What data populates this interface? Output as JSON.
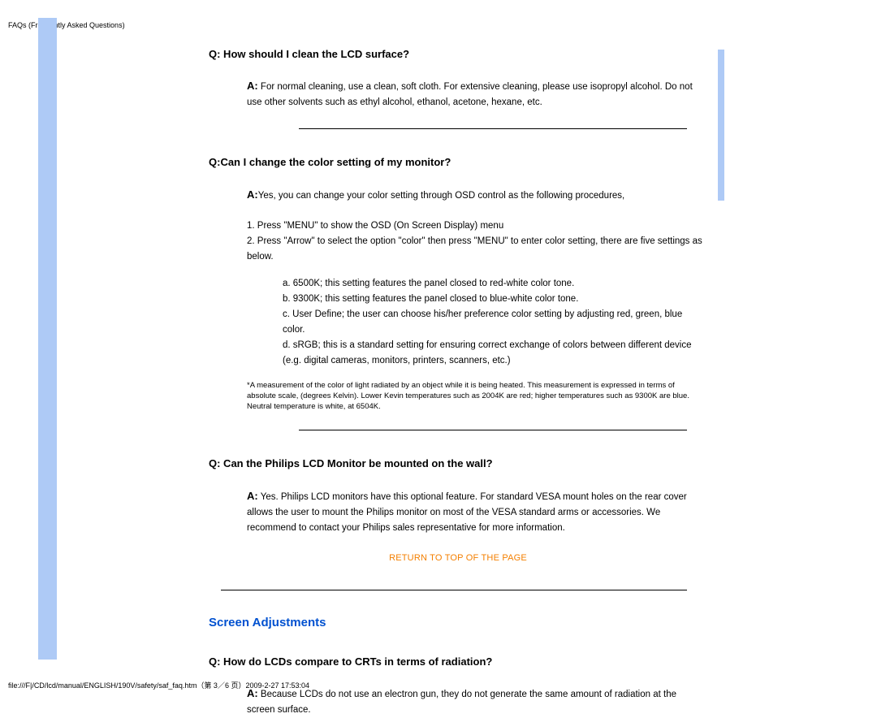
{
  "header": "FAQs (Frequently Asked Questions)",
  "faq1": {
    "q": "Q: How should I clean the LCD surface?",
    "a_label": "A:",
    "a": " For normal cleaning, use a clean, soft cloth. For extensive cleaning, please use isopropyl alcohol. Do not use other solvents such as ethyl alcohol, ethanol, acetone, hexane, etc."
  },
  "faq2": {
    "q": "Q:Can I change the color setting of my monitor?",
    "a_label": "A:",
    "a": "Yes, you can change your color setting through OSD control as the following procedures,",
    "step1": "1. Press \"MENU\" to show the OSD (On Screen Display) menu",
    "step2": "2. Press \"Arrow\" to select the option \"color\" then press \"MENU\" to enter color setting, there are five settings as below.",
    "opt_a": "a. 6500K; this setting features the panel closed to red-white color tone.",
    "opt_b": "b. 9300K; this setting features the panel closed to blue-white color tone.",
    "opt_c": "c. User Define; the user can choose his/her preference color setting by adjusting red, green, blue color.",
    "opt_d": "d. sRGB; this is a standard setting for ensuring correct exchange of colors between different device (e.g. digital cameras, monitors, printers, scanners, etc.)",
    "footnote": "*A measurement of the color of light radiated by an object while it is being heated. This measurement is expressed in terms of absolute scale, (degrees Kelvin). Lower Kevin temperatures such as 2004K are red; higher temperatures such as 9300K are blue. Neutral temperature is white, at 6504K."
  },
  "faq3": {
    "q": "Q: Can the Philips LCD Monitor be mounted on the wall?",
    "a_label": "A:",
    "a": " Yes. Philips LCD monitors have this optional feature. For standard VESA mount holes on the rear cover allows the user to mount the Philips monitor on most of the VESA standard arms or accessories. We recommend to contact your Philips sales representative for more information."
  },
  "return_link": "RETURN TO TOP OF THE PAGE",
  "section_heading": "Screen Adjustments",
  "faq4": {
    "q": "Q: How do LCDs compare to CRTs in terms of radiation?",
    "a_label": "A:",
    "a": " Because LCDs do not use an electron gun, they do not generate the same amount of radiation at the screen surface."
  },
  "footer": "file:///F|/CD/lcd/manual/ENGLISH/190V/safety/saf_faq.htm（第 3／6 页）2009-2-27 17:53:04"
}
